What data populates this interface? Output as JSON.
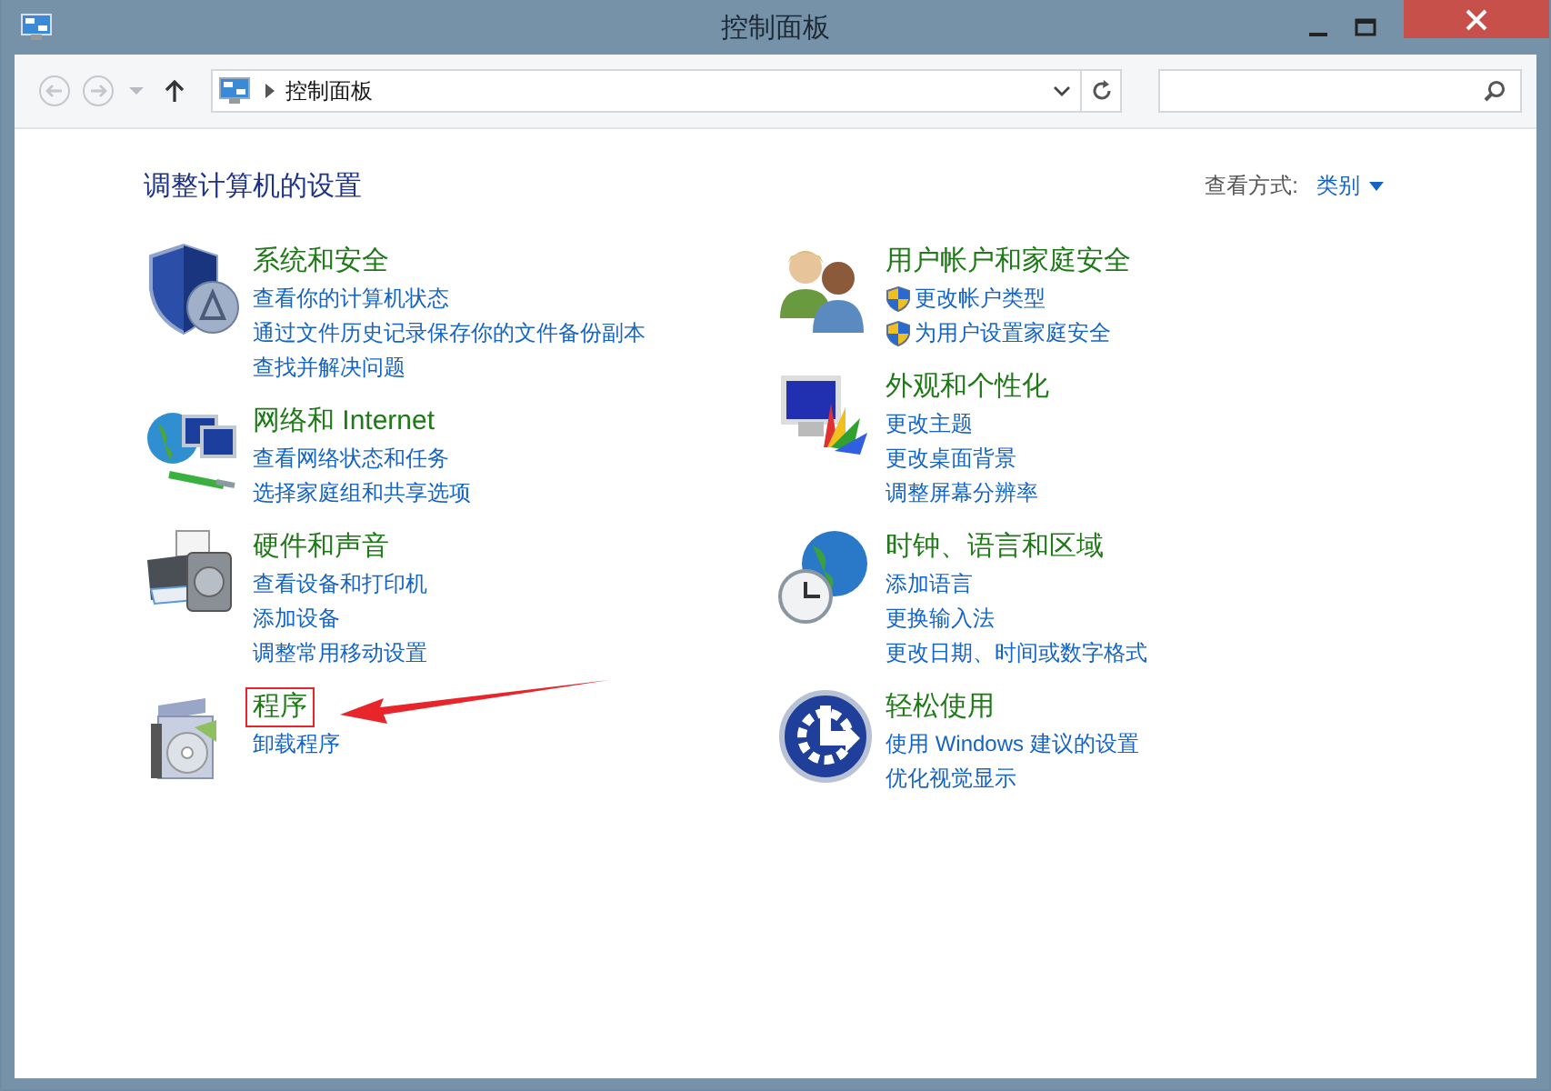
{
  "window": {
    "title": "控制面板"
  },
  "address_bar": {
    "back_disabled": true,
    "forward_disabled": true,
    "path": [
      "控制面板"
    ]
  },
  "heading": "调整计算机的设置",
  "view_by": {
    "label": "查看方式:",
    "value": "类别"
  },
  "columns": [
    {
      "categories": [
        {
          "title": "系统和安全",
          "highlighted": false,
          "links": [
            {
              "text": "查看你的计算机状态"
            },
            {
              "text": "通过文件历史记录保存你的文件备份副本"
            },
            {
              "text": "查找并解决问题"
            }
          ]
        },
        {
          "title": "网络和 Internet",
          "highlighted": false,
          "links": [
            {
              "text": "查看网络状态和任务"
            },
            {
              "text": "选择家庭组和共享选项"
            }
          ]
        },
        {
          "title": "硬件和声音",
          "highlighted": false,
          "links": [
            {
              "text": "查看设备和打印机"
            },
            {
              "text": "添加设备"
            },
            {
              "text": "调整常用移动设置"
            }
          ]
        },
        {
          "title": "程序",
          "highlighted": true,
          "links": [
            {
              "text": "卸载程序"
            }
          ]
        }
      ]
    },
    {
      "categories": [
        {
          "title": "用户帐户和家庭安全",
          "highlighted": false,
          "links": [
            {
              "text": "更改帐户类型",
              "kind": "shield"
            },
            {
              "text": "为用户设置家庭安全",
              "kind": "shield"
            }
          ]
        },
        {
          "title": "外观和个性化",
          "highlighted": false,
          "links": [
            {
              "text": "更改主题"
            },
            {
              "text": "更改桌面背景"
            },
            {
              "text": "调整屏幕分辨率"
            }
          ]
        },
        {
          "title": "时钟、语言和区域",
          "highlighted": false,
          "links": [
            {
              "text": "添加语言"
            },
            {
              "text": "更换输入法"
            },
            {
              "text": "更改日期、时间或数字格式"
            }
          ]
        },
        {
          "title": "轻松使用",
          "highlighted": false,
          "links": [
            {
              "text": "使用 Windows 建议的设置"
            },
            {
              "text": "优化视觉显示"
            }
          ]
        }
      ]
    }
  ]
}
